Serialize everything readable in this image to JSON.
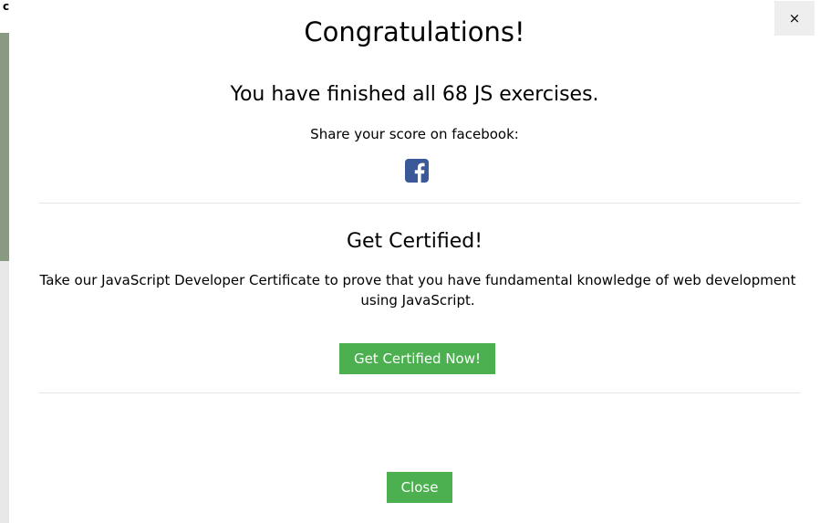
{
  "background_page": {
    "edge_char": "c"
  },
  "modal": {
    "close_symbol": "×",
    "title": "Congratulations!",
    "finished_text": "You have finished all 68 JS exercises.",
    "share_text": "Share your score on facebook:",
    "facebook_icon": "facebook-square-icon",
    "certified_title": "Get Certified!",
    "certified_text": "Take our JavaScript Developer Certificate to prove that you have fundamental knowledge of web development using JavaScript.",
    "certified_button": "Get Certified Now!",
    "close_button": "Close"
  },
  "colors": {
    "accent_green": "#4caf50",
    "facebook_blue": "#3b5998",
    "close_bg": "#eeeeee"
  }
}
